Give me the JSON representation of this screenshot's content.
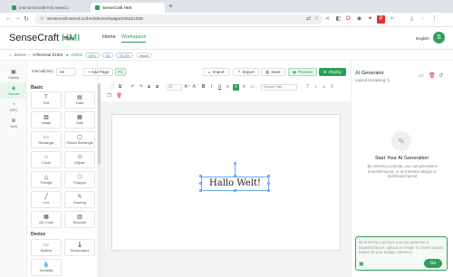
{
  "browser": {
    "tabs": [
      {
        "label": "test-sensecraft-hmi.seeed.c"
      },
      {
        "label": "SenseCraft HMI"
      }
    ],
    "new_tab": "+",
    "url": "sensecraft.seeed.cc/hmi/device/epaper/35221035"
  },
  "app": {
    "logo_main": "SenseCraft",
    "logo_accent": " HMI",
    "beta": "Beta",
    "nav": [
      "Home",
      "Workspace"
    ],
    "language": "English",
    "avatar": "S"
  },
  "project": {
    "device_label": "Device",
    "device_name": "reTerminal E1001",
    "status": "Online",
    "badges": [
      "84%",
      "E5",
      "23.2%",
      "ebook"
    ]
  },
  "rail": [
    {
      "label": "Gallery",
      "icon": "gallery-icon"
    },
    {
      "label": "Canvas",
      "icon": "canvas-icon"
    },
    {
      "label": "RSS",
      "icon": "rss-icon"
    },
    {
      "label": "Web",
      "icon": "web-icon"
    }
  ],
  "toolbar": {
    "interval_label": "Interval(min)",
    "interval_value": "60",
    "add_page": "+ Add Page",
    "page_badge": "P1",
    "import": "Import",
    "export": "Export",
    "save": "Save",
    "preview": "Preview",
    "deploy": "Deploy",
    "font_size": "20",
    "font_family": "Source Han ..."
  },
  "panel": {
    "basic_title": "Basic",
    "basic": [
      "Text",
      "Data",
      "Image",
      "Date",
      "Rectangle",
      "Round Rectangle",
      "Circle",
      "Ellipse",
      "Triangle",
      "Polygon",
      "Line",
      "Drawing",
      "QR Code",
      "Barcode"
    ],
    "device_title": "Device",
    "device": [
      "Battery",
      "Temperature",
      "Humidity"
    ]
  },
  "canvas": {
    "text": "Hallo Welt!"
  },
  "ai": {
    "title_a": "AI",
    "title_b": " Generator",
    "remaining": "Layout remaining: 5",
    "start": "Start Your AI Generation",
    "desc": "By entering a prompt, you can generate a beautiful layout, or an interface design or dashboard layout",
    "placeholder": "By entering a prompt, you can generate a beautiful layout, upload an image to create layouts based on your design reference",
    "send": "Go"
  }
}
